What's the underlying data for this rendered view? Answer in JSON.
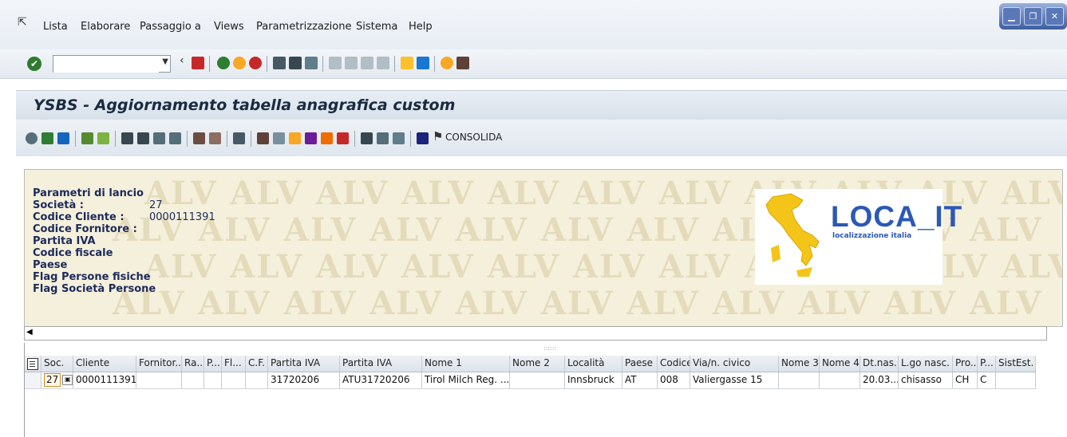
{
  "menubar": {
    "items": [
      "Lista",
      "Elaborare",
      "Passaggio a",
      "Views",
      "Parametrizzazione",
      "Sistema",
      "Help"
    ],
    "underline_letters": [
      "L",
      "E",
      "P",
      "V",
      "",
      "S",
      "H"
    ]
  },
  "toolbar": {
    "command_value": "",
    "command_placeholder": ""
  },
  "title": "YSBS - Aggiornamento tabella anagrafica custom",
  "app_toolbar": {
    "consolida_label": "CONSOLIDA"
  },
  "header": {
    "heading": "Parametri di lancio",
    "fields": [
      {
        "label": "Società :",
        "value": "27"
      },
      {
        "label": "Codice Cliente :",
        "value": "0000111391"
      },
      {
        "label": "Codice Fornitore :",
        "value": ""
      },
      {
        "label": "Partita IVA",
        "value": ""
      },
      {
        "label": "Codice fiscale",
        "value": ""
      },
      {
        "label": "Paese",
        "value": ""
      },
      {
        "label": "Flag Persone fisiche",
        "value": ""
      },
      {
        "label": "Flag Società Persone",
        "value": ""
      }
    ],
    "watermark": "ALV",
    "logo": {
      "title": "LOCA_IT",
      "subtitle": "localizzazione italia"
    }
  },
  "grid": {
    "columns": [
      "Soc.",
      "Cliente",
      "Fornitor...",
      "Ra...",
      "P...",
      "Fl...",
      "C.F.",
      "Partita IVA",
      "Partita IVA",
      "Nome 1",
      "Nome 2",
      "Località",
      "Paese",
      "Codice...",
      "Via/n. civico",
      "Nome 3",
      "Nome 4",
      "Dt.nas...",
      "L.go nasc.",
      "Pro...",
      "P...",
      "SistEst."
    ],
    "rows": [
      [
        "27",
        "0000111391",
        "",
        "",
        "",
        "",
        "",
        "31720206",
        "ATU31720206",
        "Tirol Milch Reg. ...",
        "",
        "Innsbruck",
        "AT",
        "008",
        "Valiergasse 15",
        "",
        "",
        "20.03...",
        "chisasso",
        "CH",
        "C",
        ""
      ]
    ]
  },
  "colors": {
    "accent": "#2b59b6",
    "title_text": "#1a2b40",
    "header_bg": "#f5f0dc",
    "window_controls": "#3e5ea0"
  }
}
